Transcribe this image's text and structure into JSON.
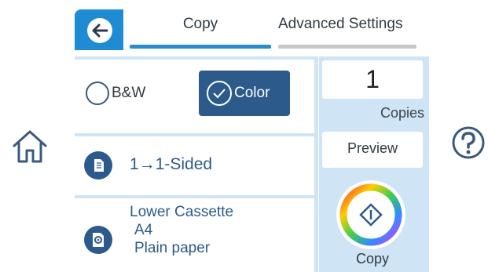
{
  "header": {
    "tabs": [
      {
        "label": "Copy"
      },
      {
        "label": "Advanced Settings"
      }
    ]
  },
  "color_mode": {
    "bw_label": "B&W",
    "color_label": "Color"
  },
  "sides": {
    "label": "1→1-Sided"
  },
  "paper": {
    "source": "Lower Cassette",
    "size": "A4",
    "type": "Plain paper"
  },
  "copies": {
    "value": "1",
    "label": "Copies"
  },
  "preview_label": "Preview",
  "start_label": "Copy",
  "colors": {
    "accent": "#2a8bcf",
    "selected": "#2c5a8b",
    "panel": "#cfe4f4"
  }
}
